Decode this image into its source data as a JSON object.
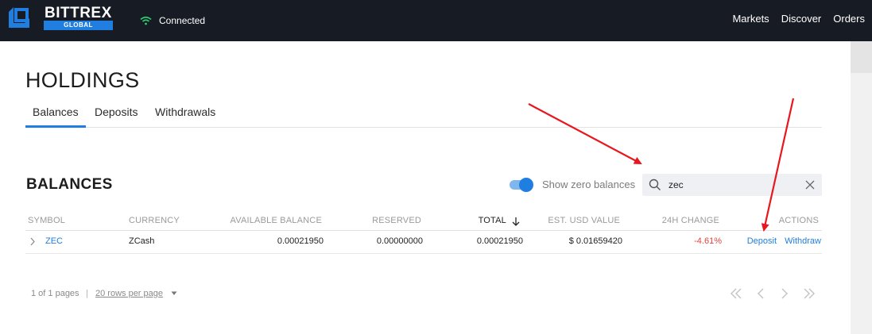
{
  "topbar": {
    "logo_text": "BITTREX",
    "logo_sub": "GLOBAL",
    "connection_status": "Connected",
    "nav": [
      "Markets",
      "Discover",
      "Orders"
    ]
  },
  "page": {
    "title": "HOLDINGS",
    "tabs": [
      {
        "label": "Balances",
        "active": true
      },
      {
        "label": "Deposits",
        "active": false
      },
      {
        "label": "Withdrawals",
        "active": false
      }
    ]
  },
  "balances": {
    "title": "BALANCES",
    "show_zero_label": "Show zero balances",
    "show_zero_enabled": true,
    "search_value": "zec",
    "columns": {
      "symbol": "SYMBOL",
      "currency": "CURRENCY",
      "available": "AVAILABLE BALANCE",
      "reserved": "RESERVED",
      "total": "TOTAL",
      "usd": "EST. USD VALUE",
      "change": "24H CHANGE",
      "actions": "ACTIONS"
    },
    "rows": [
      {
        "symbol": "ZEC",
        "currency": "ZCash",
        "available": "0.00021950",
        "reserved": "0.00000000",
        "total": "0.00021950",
        "usd": "$ 0.01659420",
        "change": "-4.61%",
        "deposit": "Deposit",
        "withdraw": "Withdraw"
      }
    ]
  },
  "pagination": {
    "info": "1 of 1 pages",
    "separator": "|",
    "rows_per_page": "20 rows per page"
  },
  "colors": {
    "accent": "#1f7ee0",
    "topbar": "#171c24",
    "negative": "#e0443a",
    "connected": "#2ecc71",
    "annotation": "#e8171f"
  }
}
